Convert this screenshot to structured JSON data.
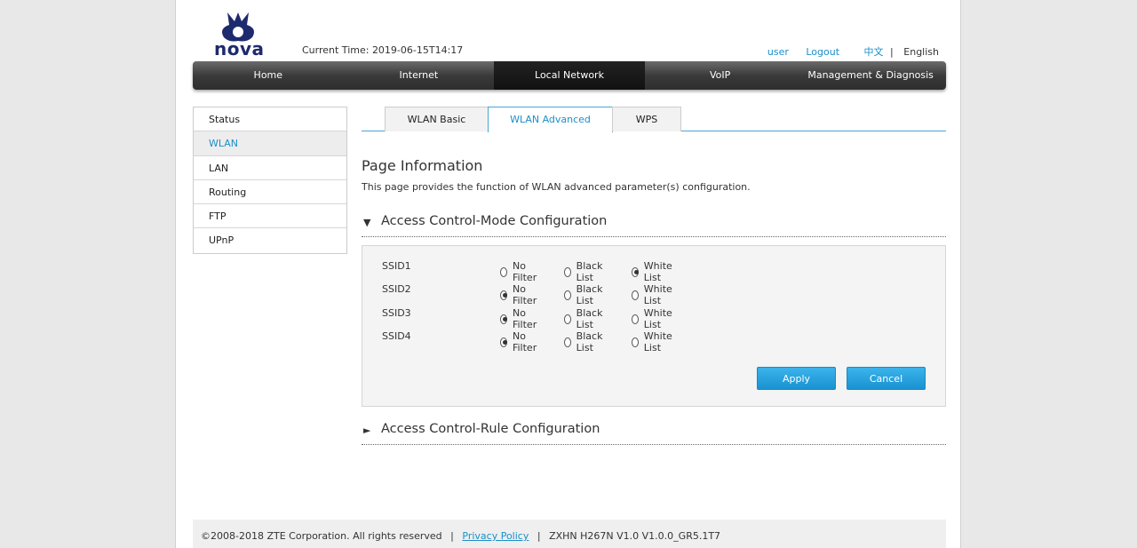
{
  "header": {
    "logo_text": "nova",
    "current_time_label": "Current Time:",
    "current_time": "2019-06-15T14:17",
    "user": "user",
    "logout": "Logout",
    "lang_cn": "中文",
    "lang_sep": "|",
    "lang_en": "English"
  },
  "nav": {
    "items": [
      "Home",
      "Internet",
      "Local Network",
      "VoIP",
      "Management & Diagnosis"
    ],
    "active": "Local Network"
  },
  "sidebar": {
    "items": [
      "Status",
      "WLAN",
      "LAN",
      "Routing",
      "FTP",
      "UPnP"
    ],
    "active": "WLAN"
  },
  "tabs": {
    "items": [
      "WLAN Basic",
      "WLAN Advanced",
      "WPS"
    ],
    "active": "WLAN Advanced"
  },
  "page_info": {
    "title": "Page Information",
    "description": "This page provides the function of WLAN advanced parameter(s) configuration."
  },
  "section_mode": {
    "arrow": "▼",
    "title": "Access Control-Mode Configuration",
    "options": [
      "No Filter",
      "Black List",
      "White List"
    ],
    "rows": [
      {
        "ssid": "SSID1",
        "selected": "White List"
      },
      {
        "ssid": "SSID2",
        "selected": "No Filter"
      },
      {
        "ssid": "SSID3",
        "selected": "No Filter"
      },
      {
        "ssid": "SSID4",
        "selected": "No Filter"
      }
    ],
    "apply": "Apply",
    "cancel": "Cancel"
  },
  "section_rule": {
    "arrow": "►",
    "title": "Access Control-Rule Configuration"
  },
  "footer": {
    "copyright": "©2008-2018 ZTE Corporation. All rights reserved",
    "sep": "|",
    "privacy": "Privacy Policy",
    "version": "ZXHN H267N V1.0 V1.0.0_GR5.1T7"
  },
  "colors": {
    "accent": "#1a8fc9",
    "nav_bg": "#3a3a3a",
    "logo": "#1e2a6e"
  }
}
